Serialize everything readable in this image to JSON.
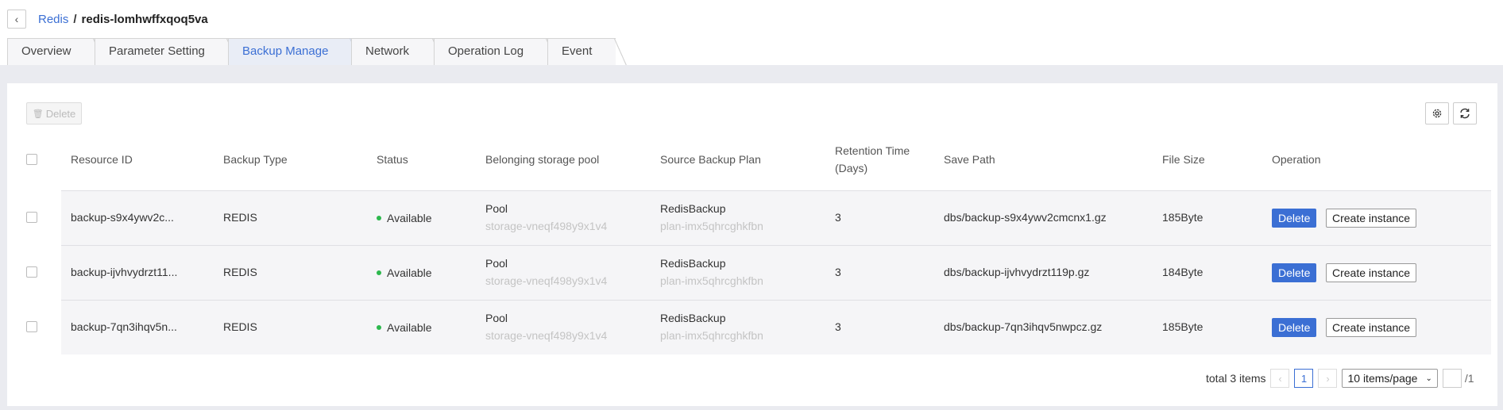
{
  "breadcrumb": {
    "parent": "Redis",
    "separator": "/",
    "current": "redis-lomhwffxqoq5va"
  },
  "tabs": [
    "Overview",
    "Parameter Setting",
    "Backup Manage",
    "Network",
    "Operation Log",
    "Event"
  ],
  "active_tab": "Backup Manage",
  "toolbar": {
    "delete_label": "Delete"
  },
  "columns": [
    "Resource ID",
    "Backup Type",
    "Status",
    "Belonging storage pool",
    "Source Backup Plan",
    "Retention Time (Days)",
    "Save Path",
    "File Size",
    "Operation"
  ],
  "rows": [
    {
      "resource_id": "backup-s9x4ywv2c...",
      "backup_type": "REDIS",
      "status": "Available",
      "pool_name": "Pool",
      "pool_id": "storage-vneqf498y9x1v4",
      "plan_name": "RedisBackup",
      "plan_id": "plan-imx5qhrcghkfbn",
      "retention": "3",
      "save_path": "dbs/backup-s9x4ywv2cmcnx1.gz",
      "file_size": "185Byte",
      "delete_label": "Delete",
      "create_label": "Create instance"
    },
    {
      "resource_id": "backup-ijvhvydrzt11...",
      "backup_type": "REDIS",
      "status": "Available",
      "pool_name": "Pool",
      "pool_id": "storage-vneqf498y9x1v4",
      "plan_name": "RedisBackup",
      "plan_id": "plan-imx5qhrcghkfbn",
      "retention": "3",
      "save_path": "dbs/backup-ijvhvydrzt119p.gz",
      "file_size": "184Byte",
      "delete_label": "Delete",
      "create_label": "Create instance"
    },
    {
      "resource_id": "backup-7qn3ihqv5n...",
      "backup_type": "REDIS",
      "status": "Available",
      "pool_name": "Pool",
      "pool_id": "storage-vneqf498y9x1v4",
      "plan_name": "RedisBackup",
      "plan_id": "plan-imx5qhrcghkfbn",
      "retention": "3",
      "save_path": "dbs/backup-7qn3ihqv5nwpcz.gz",
      "file_size": "185Byte",
      "delete_label": "Delete",
      "create_label": "Create instance"
    }
  ],
  "pagination": {
    "total": "total 3 items",
    "current_page": "1",
    "page_size": "10 items/page",
    "total_pages": "/1"
  },
  "colors": {
    "accent": "#3b6fd4",
    "status_available": "#2db84d",
    "page_bg": "#eaebf0"
  },
  "icons": {
    "back": "chevron-left-icon",
    "settings": "gear-icon",
    "refresh": "refresh-icon",
    "trash": "trash-icon"
  }
}
